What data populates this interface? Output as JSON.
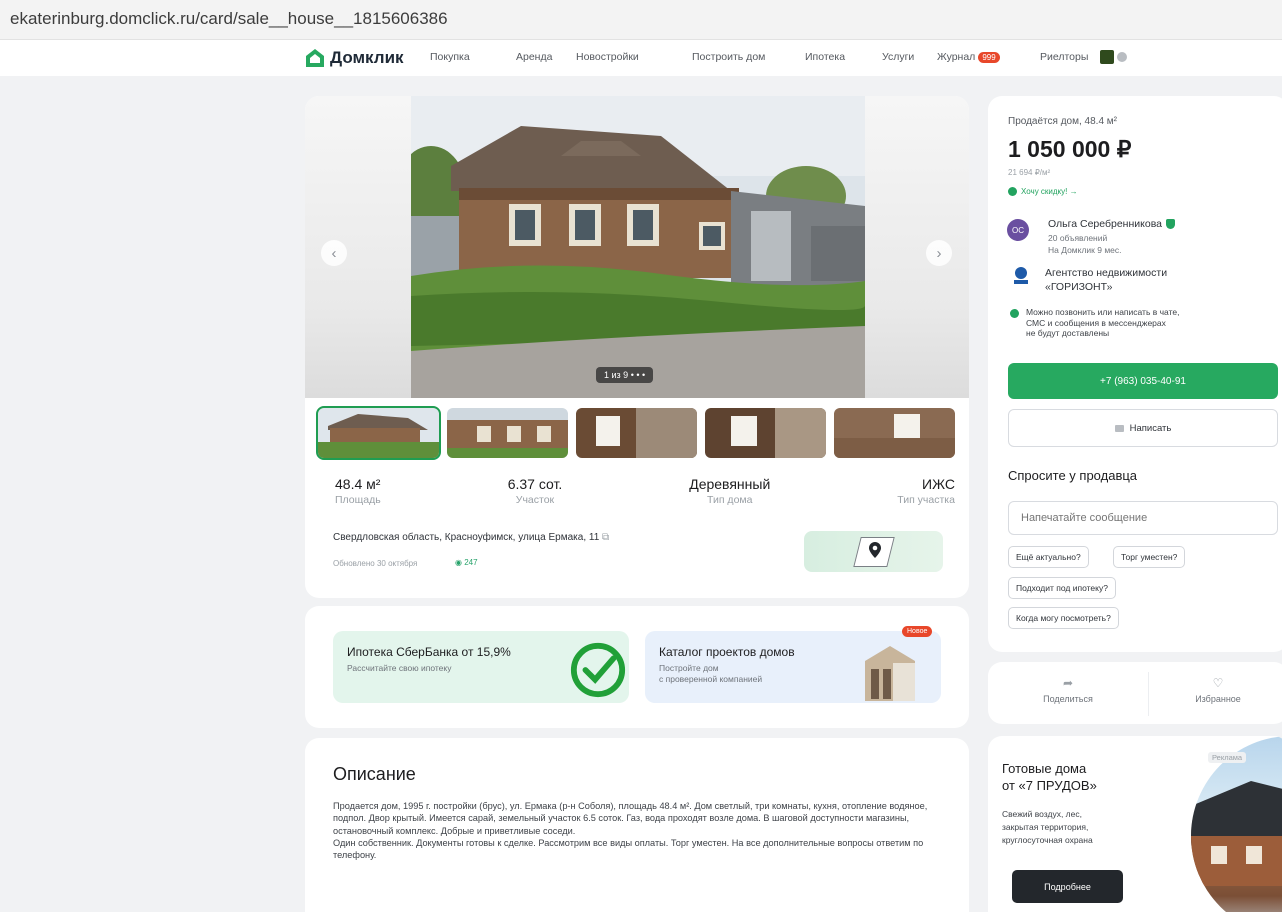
{
  "browser": {
    "url": "ekaterinburg.domclick.ru/card/sale__house__1815606386"
  },
  "header": {
    "logo": "Домклик",
    "nav": [
      "Покупка",
      "Аренда",
      "Новостройки",
      "Построить дом",
      "Ипотека",
      "Услуги",
      "Журнал",
      "Риелторы"
    ],
    "journal_badge": "999"
  },
  "gallery": {
    "counter": "1 из 9",
    "prev_arrow": "‹",
    "next_arrow": "›"
  },
  "specs": [
    {
      "value": "48.4 м²",
      "label": "Площадь"
    },
    {
      "value": "6.37 сот.",
      "label": "Участок"
    },
    {
      "value": "Деревянный",
      "label": "Тип дома"
    },
    {
      "value": "ИЖС",
      "label": "Тип участка"
    }
  ],
  "address": "Свердловская область, Красноуфимск, улица Ермака, 11",
  "updated": "Обновлено 30 октября",
  "views": "247",
  "promos": {
    "mortgage_title": "Ипотека СберБанка от 15,9%",
    "mortgage_sub": "Рассчитайте свою ипотеку",
    "catalog_title": "Каталог проектов домов",
    "catalog_sub": "Постройте дом\nс проверенной компанией",
    "new_badge": "Новое"
  },
  "description": {
    "title": "Описание",
    "para1": "Продается дом, 1995 г. постройки (брус), ул. Ермака (р-н Соболя), площадь 48.4 м². Дом светлый, три комнаты, кухня, отопление водяное, подпол. Двор крытый. Имеется сарай, земельный участок 6.5 соток. Газ, вода проходят возле дома. В шаговой доступности магазины, остановочный комплекс. Добрые и приветливые соседи.",
    "para2": "Один собственник. Документы готовы к сделке. Рассмотрим все виды оплаты. Торг уместен. На все дополнительные вопросы ответим по телефону."
  },
  "sidebar": {
    "type": "Продаётся дом, 48.4 м²",
    "price": "1 050 000 ₽",
    "price_per_m": "21 694 ₽/м²",
    "discount": "Хочу скидку! →",
    "seller_initials": "ОС",
    "seller_name": "Ольга Серебренникова",
    "seller_ads": "20 объявлений",
    "seller_since": "На Домклик 9 мес.",
    "agency": "Агентство недвижимости\n«ГОРИЗОНТ»",
    "note": "Можно позвонить или написать в чате,\nСМС и сообщения в мессенджерах\nне будут доставлены",
    "phone": "+7 (963) 035-40-91",
    "write": "Написать",
    "ask_title": "Спросите у продавца",
    "input_placeholder": "Напечатайте сообщение",
    "chips": [
      "Ещё актуально?",
      "Торг уместен?",
      "Подходит под ипотеку?",
      "Когда могу посмотреть?"
    ]
  },
  "actions": {
    "share": "Поделиться",
    "favorite": "Избранное"
  },
  "ad": {
    "title": "Готовые дома\nот «7 ПРУДОВ»",
    "text": "Свежий воздух, лес,\nзакрытая территория,\nкруглосуточная охрана",
    "button": "Подробнее",
    "label": "Реклама"
  },
  "colors": {
    "brand_green": "#27a960",
    "badge_red": "#e8472a"
  }
}
